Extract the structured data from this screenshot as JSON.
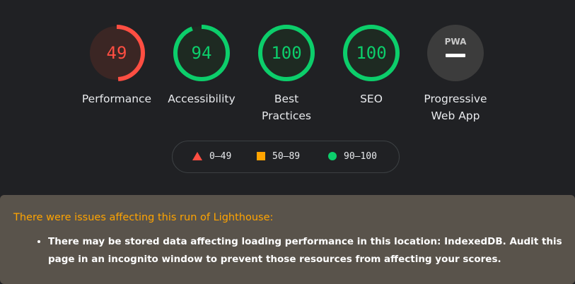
{
  "gauges": [
    {
      "score": "49",
      "label": "Performance",
      "value": 49,
      "color": "#ff4e42",
      "bg": "#3b2624"
    },
    {
      "score": "94",
      "label": "Accessibility",
      "value": 94,
      "color": "#0cce6b",
      "bg": "#1e2a22"
    },
    {
      "score": "100",
      "label": "Best Practices",
      "value": 100,
      "color": "#0cce6b",
      "bg": "#1e2a22"
    },
    {
      "score": "100",
      "label": "SEO",
      "value": 100,
      "color": "#0cce6b",
      "bg": "#1e2a22"
    }
  ],
  "pwa": {
    "badge_text": "PWA",
    "label": "Progressive Web App",
    "bg": "#3c3c3c",
    "icon": "pwa-badge-icon"
  },
  "legend": [
    {
      "range": "0–49",
      "shape": "triangle",
      "color": "#ff4e42"
    },
    {
      "range": "50–89",
      "shape": "square",
      "color": "#ffa400"
    },
    {
      "range": "90–100",
      "shape": "circle",
      "color": "#0cce6b"
    }
  ],
  "warning": {
    "title": "There were issues affecting this run of Lighthouse:",
    "items": [
      "There may be stored data affecting loading performance in this location: IndexedDB. Audit this page in an incognito window to prevent those resources from affecting your scores."
    ],
    "title_color": "#ffa400",
    "bg": "#59534b"
  }
}
